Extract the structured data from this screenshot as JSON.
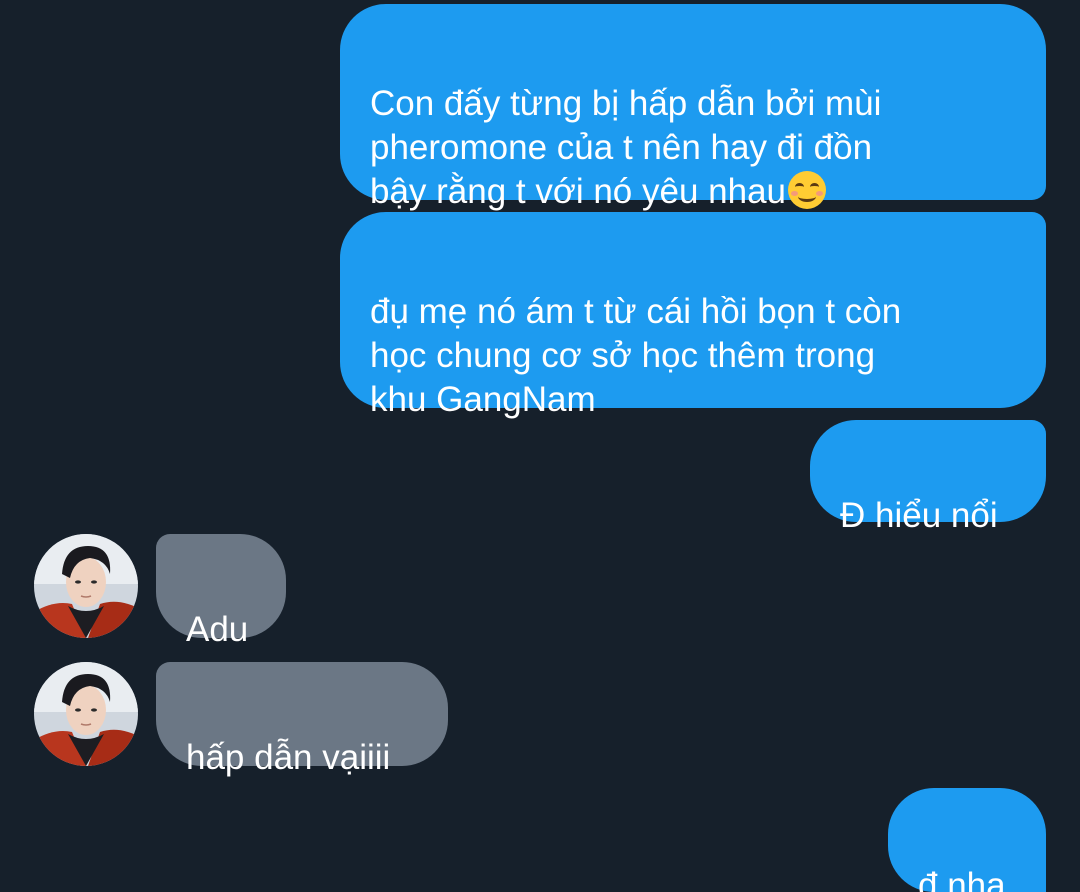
{
  "messages": [
    {
      "direction": "outgoing",
      "text": "Con đấy từng bị hấp dẫn bởi mùi\npheromone của t nên hay đi đồn\nbậy rằng t với nó yêu nhau",
      "emoji": "smiling-face-with-smiling-eyes"
    },
    {
      "direction": "outgoing",
      "text": "đụ mẹ nó ám t từ cái hồi bọn t còn\nhọc chung cơ sở học thêm trong\nkhu GangNam"
    },
    {
      "direction": "outgoing",
      "text": "Đ hiểu nổi"
    },
    {
      "direction": "incoming",
      "text": "Adu",
      "avatar": "contact-avatar"
    },
    {
      "direction": "incoming",
      "text": "hấp dẫn vạiiii",
      "avatar": "contact-avatar"
    },
    {
      "direction": "outgoing",
      "text": "đ nha"
    }
  ],
  "colors": {
    "background": "#16202b",
    "outgoing_bubble": "#1d9bf0",
    "incoming_bubble": "#6b7785",
    "text": "#ffffff"
  }
}
